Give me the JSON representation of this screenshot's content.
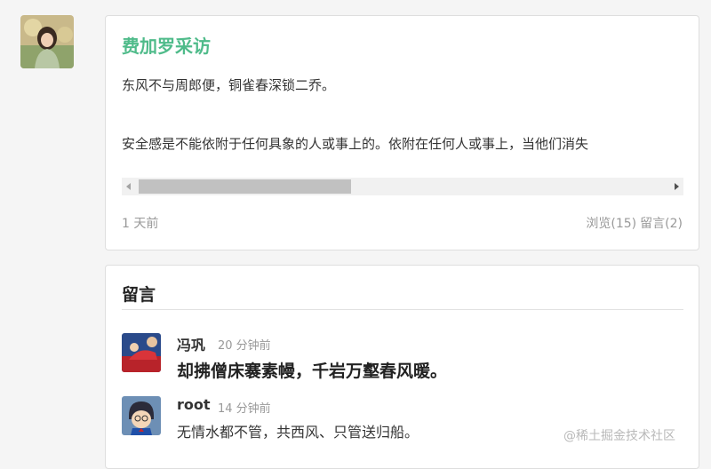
{
  "post": {
    "title": "费加罗采访",
    "paragraph1": "东风不与周郎便，铜雀春深锁二乔。",
    "paragraph2": "安全感是不能依附于任何具象的人或事上的。依附在任何人或事上，当他们消失",
    "time": "1 天前",
    "views": "浏览(15)",
    "comments_count": "留言(2)"
  },
  "comments_section": {
    "heading": "留言",
    "items": [
      {
        "name": "冯巩",
        "time": "20 分钟前",
        "text": "却拂僧床褰素幔，千岩万壑春风暖。"
      },
      {
        "name": "root",
        "time": "14 分钟前",
        "text": "无情水都不管，共西风、只管送归船。"
      }
    ]
  },
  "watermark": "@稀土掘金技术社区",
  "colors": {
    "title_accent": "#4fbb8a",
    "muted": "#999999"
  }
}
